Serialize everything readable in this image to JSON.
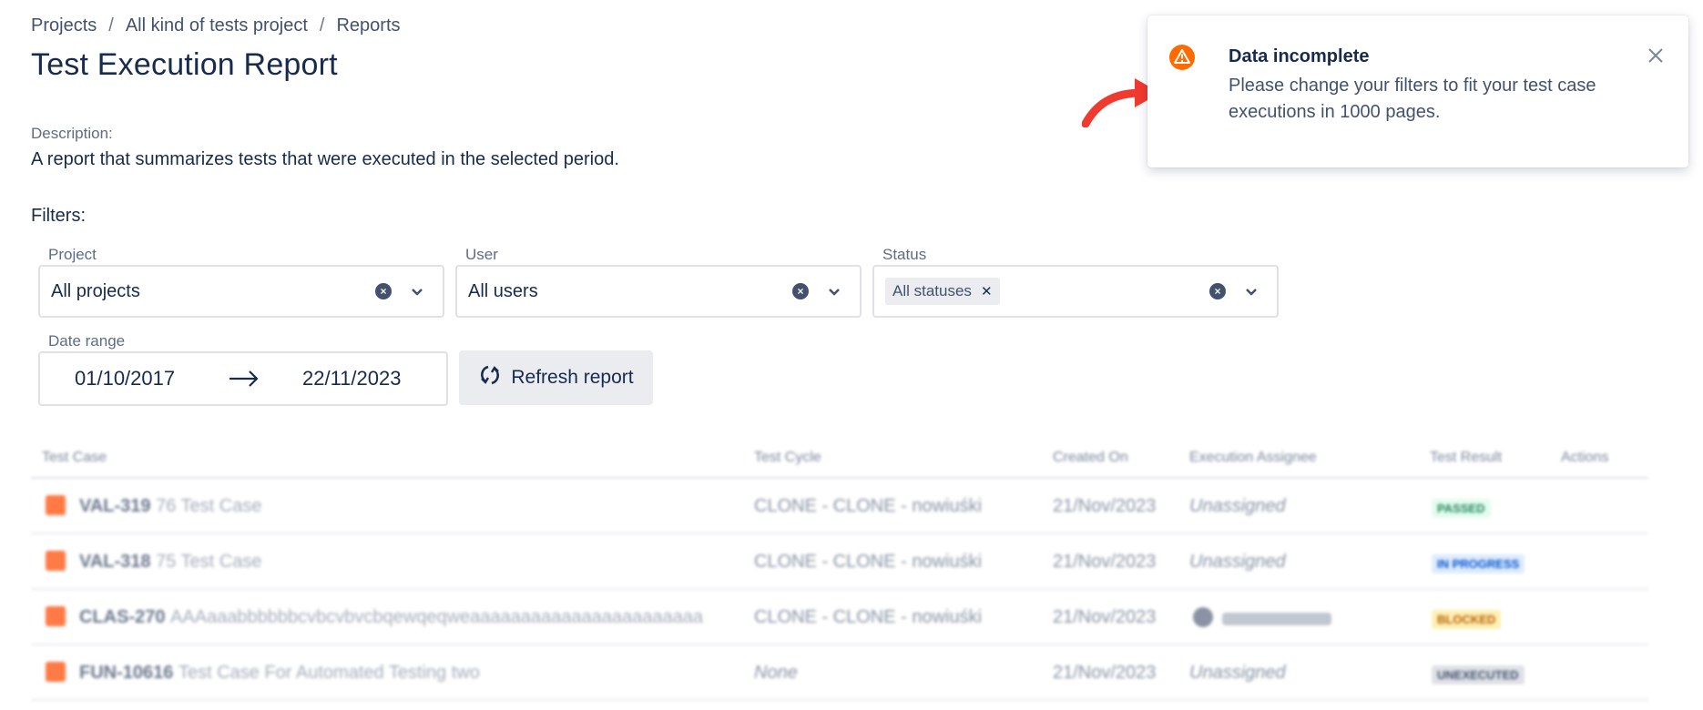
{
  "breadcrumb": [
    "Projects",
    "All kind of tests project",
    "Reports"
  ],
  "breadcrumb_separator": "/",
  "page": {
    "title": "Test Execution Report",
    "description_label": "Description:",
    "description": "A report that summarizes tests that were executed in the selected period.",
    "filters_label": "Filters:"
  },
  "filters": {
    "project": {
      "label": "Project",
      "value": "All projects"
    },
    "user": {
      "label": "User",
      "value": "All users"
    },
    "status": {
      "label": "Status",
      "tag": "All statuses"
    },
    "date_range": {
      "label": "Date range",
      "from": "01/10/2017",
      "to": "22/11/2023"
    },
    "refresh_label": "Refresh report"
  },
  "table": {
    "columns": [
      "Test Case",
      "Test Cycle",
      "Created On",
      "Execution Assignee",
      "Test Result",
      "Actions"
    ],
    "rows": [
      {
        "key": "VAL-319",
        "name": "76 Test Case",
        "cycle": "CLONE - CLONE - nowiuśki",
        "created": "21/Nov/2023",
        "assignee": "Unassigned",
        "result": "PASSED"
      },
      {
        "key": "VAL-318",
        "name": "75 Test Case",
        "cycle": "CLONE - CLONE - nowiuśki",
        "created": "21/Nov/2023",
        "assignee": "Unassigned",
        "result": "IN PROGRESS"
      },
      {
        "key": "CLAS-270",
        "name": "AAAaaabbbbbbcvbcvbvcbqewqeqweaaaaaaaaaaaaaaaaaaaaaaa",
        "cycle": "CLONE - CLONE - nowiuśki",
        "created": "21/Nov/2023",
        "assignee": "",
        "result": "BLOCKED"
      },
      {
        "key": "FUN-10616",
        "name": "Test Case For Automated Testing two",
        "cycle": "None",
        "created": "21/Nov/2023",
        "assignee": "Unassigned",
        "result": "UNEXECUTED"
      }
    ]
  },
  "toast": {
    "title": "Data incomplete",
    "message": "Please change your filters to fit your test case executions in 1000 pages.",
    "icon": "warning-icon",
    "accent": "#ff6b00"
  },
  "colors": {
    "annotation_arrow": "#f03a2f",
    "passed": "#1f845a",
    "in_progress": "#0052cc",
    "blocked": "#b65c02",
    "unexecuted": "#42526e"
  }
}
